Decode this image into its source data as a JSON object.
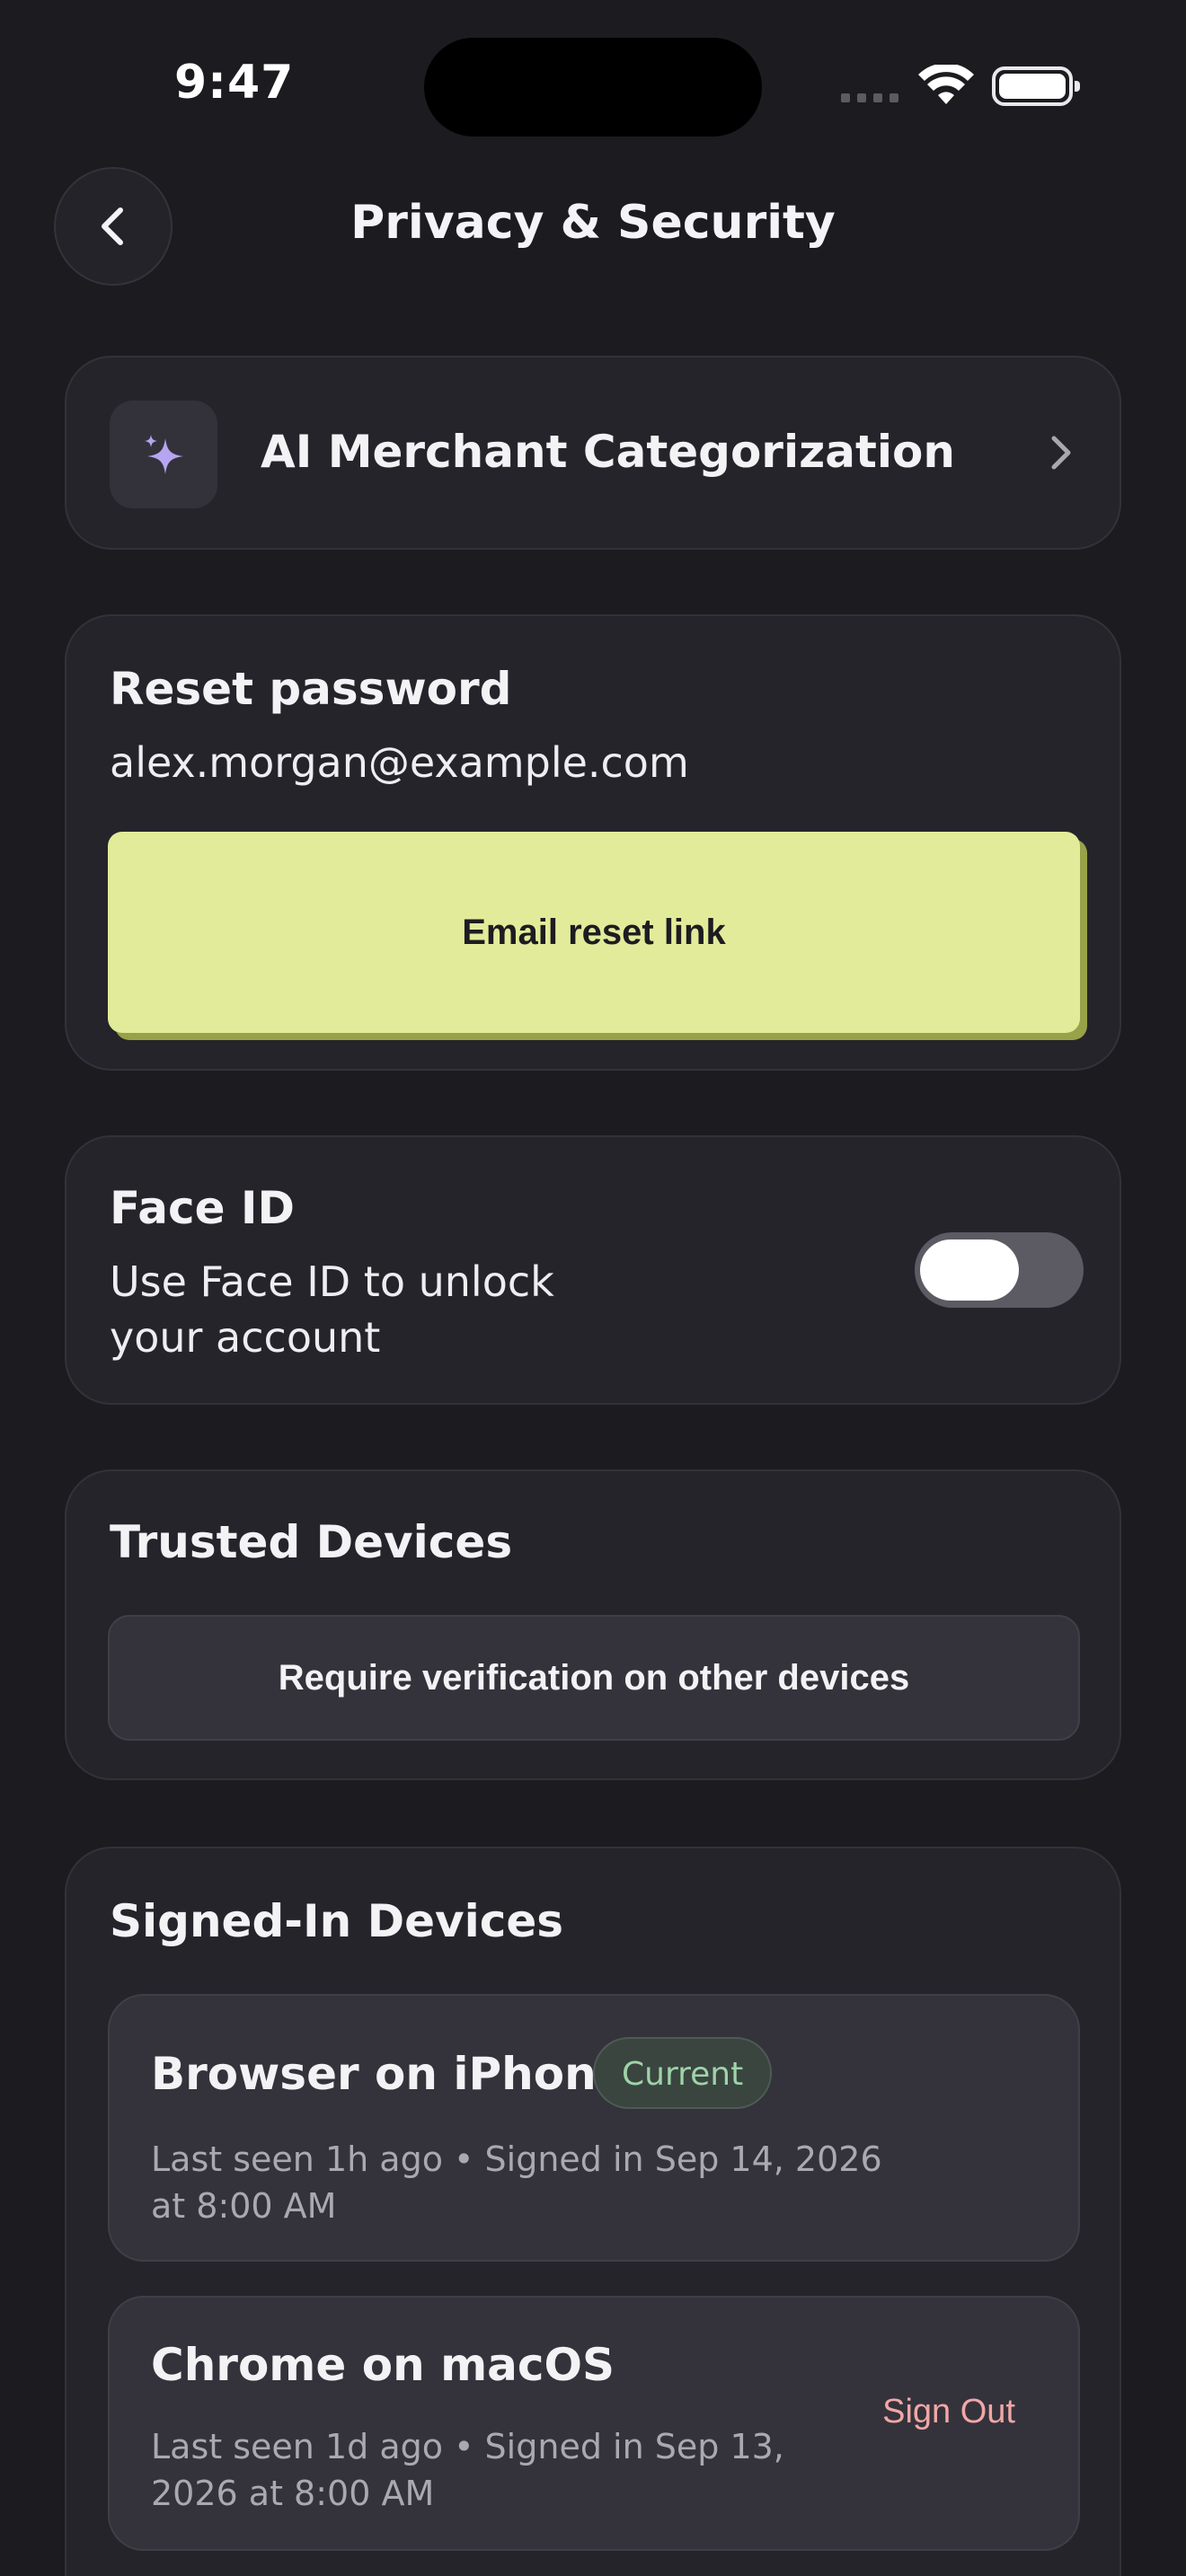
{
  "status_bar": {
    "time": "9:47"
  },
  "header": {
    "title": "Privacy & Security"
  },
  "ai_card": {
    "title": "AI Merchant Categorization",
    "icon": "sparkle-icon",
    "icon_color": "#b6a6f2"
  },
  "reset_password": {
    "title": "Reset password",
    "email": "alex.morgan@example.com",
    "button_label": "Email reset link",
    "button_color": "#e2eb99"
  },
  "face_id": {
    "title": "Face ID",
    "description": "Use Face ID to unlock your account",
    "enabled": false
  },
  "trusted_devices": {
    "title": "Trusted Devices",
    "button_label": "Require verification on other devices"
  },
  "signed_in_devices": {
    "title": "Signed-In Devices",
    "devices": [
      {
        "name": "Browser on iPhone",
        "badge": "Current",
        "meta": "Last seen 1h ago • Signed in Sep 14, 2026 at 8:00 AM"
      },
      {
        "name": "Chrome on macOS",
        "meta": "Last seen 1d ago • Signed in Sep 13, 2026 at 8:00 AM",
        "action": "Sign Out"
      }
    ]
  },
  "colors": {
    "background": "#1c1b20",
    "card": "#25242b",
    "badge_text": "#9fd3a8",
    "danger_text": "#f1a7a7"
  }
}
